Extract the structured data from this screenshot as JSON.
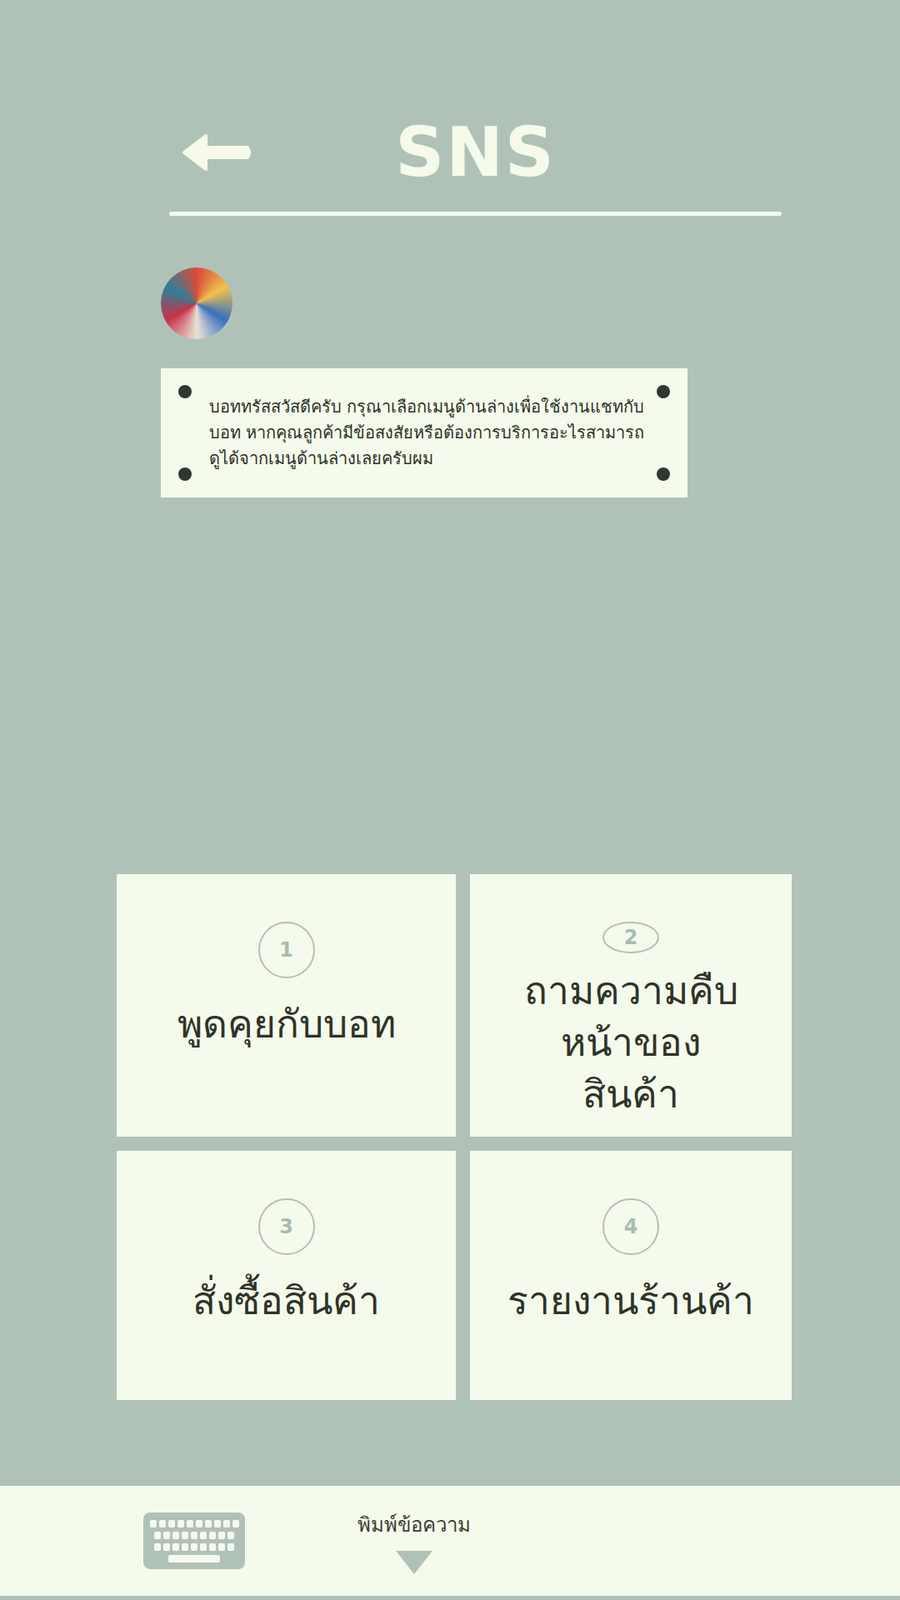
{
  "header": {
    "title": "SNS"
  },
  "message": {
    "text": "บอททรัสสวัสดีครับ กรุณาเลือกเมนูด้านล่างเพื่อใช้งานแชทกับบอท หากคุณลูกค้ามีข้อสงสัยหรือต้องการบริการอะไรสามารถดูได้จากเมนูด้านล่างเลยครับผม"
  },
  "menu": [
    {
      "number": "1",
      "label": "พูดคุยกับบอท"
    },
    {
      "number": "2",
      "label": "ถามความคืบหน้าของสินค้า"
    },
    {
      "number": "3",
      "label": "สั่งซื้อสินค้า"
    },
    {
      "number": "4",
      "label": "รายงานร้านค้า"
    }
  ],
  "input": {
    "placeholder": "พิมพ์ข้อความ"
  }
}
